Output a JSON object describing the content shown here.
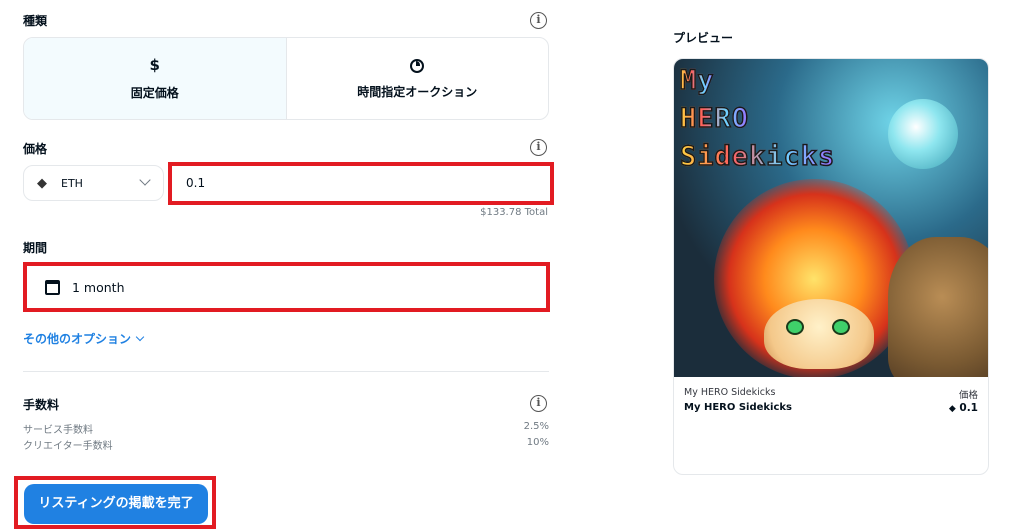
{
  "type_section": {
    "label": "種類",
    "options": [
      {
        "icon": "$",
        "label": "固定価格",
        "selected": true
      },
      {
        "icon": "clock-icon",
        "label": "時間指定オークション",
        "selected": false
      }
    ]
  },
  "price_section": {
    "label": "価格",
    "currency": "ETH",
    "amount": "0.1",
    "total": "$133.78 Total"
  },
  "duration_section": {
    "label": "期間",
    "value": "1 month"
  },
  "more_options": "その他のオプション",
  "fees": {
    "label": "手数料",
    "rows": [
      {
        "name": "サービス手数料",
        "value": "2.5%"
      },
      {
        "name": "クリエイター手数料",
        "value": "10%"
      }
    ]
  },
  "complete_button": "リスティングの掲載を完了",
  "preview": {
    "title": "プレビュー",
    "art_title_lines": [
      "My",
      "HERO",
      "Sidekicks"
    ],
    "collection": "My HERO Sidekicks",
    "name": "My HERO Sidekicks",
    "price_label": "価格",
    "price": "0.1"
  },
  "colors": {
    "accent": "#2081e2",
    "highlight_border": "#e21b22",
    "selected_bg": "#f3fbfe"
  }
}
